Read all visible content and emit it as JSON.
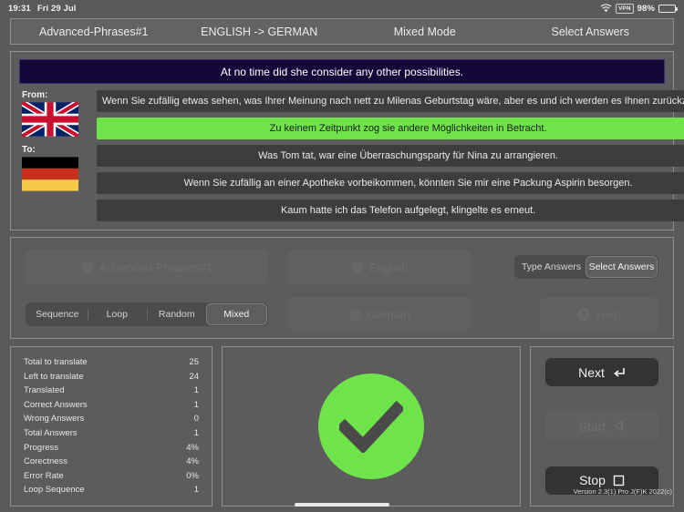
{
  "statusbar": {
    "time": "19:31",
    "date": "Fri 29 Jul",
    "vpn": "VPN",
    "battery_pct": "98%",
    "wifi_icon": "wifi-icon",
    "battery_icon": "battery-icon"
  },
  "header": {
    "tabs": [
      {
        "label": "Advanced-Phrases#1"
      },
      {
        "label": "ENGLISH -> GERMAN"
      },
      {
        "label": "Mixed Mode"
      },
      {
        "label": "Select Answers"
      }
    ]
  },
  "quiz": {
    "question": "At no time did she consider any other possibilities.",
    "from_label": "From:",
    "to_label": "To:",
    "from_flag": "uk-flag-icon",
    "to_flag": "germany-flag-icon",
    "answers": [
      {
        "text": "Wenn Sie zufällig etwas sehen, was Ihrer Meinung nach nett zu Milenas Geburtstag wäre, aber es und ich werden es Ihnen zurückzahlen.",
        "correct": false
      },
      {
        "text": "Zu keinem Zeitpunkt zog sie andere Möglichkeiten in Betracht.",
        "correct": true
      },
      {
        "text": "Was Tom tat, war eine Überraschungsparty für Nina zu arrangieren.",
        "correct": false
      },
      {
        "text": "Wenn Sie zufällig an einer Apotheke vorbeikommen, könnten Sie mir eine Packung Aspirin besorgen.",
        "correct": false
      },
      {
        "text": "Kaum hatte ich das Telefon aufgelegt, klingelte es erneut.",
        "correct": false
      }
    ]
  },
  "settings": {
    "lesson_button": "Advanced-Phrases#1",
    "from_lang_button": "English",
    "to_lang_button": "German",
    "help_button": "Help",
    "mode_segments": [
      {
        "label": "Sequence",
        "active": false
      },
      {
        "label": "Loop",
        "active": false
      },
      {
        "label": "Random",
        "active": false
      },
      {
        "label": "Mixed",
        "active": true
      }
    ],
    "answer_segments": [
      {
        "label": "Type Answers",
        "active": false
      },
      {
        "label": "Select Answers",
        "active": true
      }
    ]
  },
  "stats": [
    {
      "label": "Total to translate",
      "value": "25"
    },
    {
      "label": "Left to translate",
      "value": "24"
    },
    {
      "label": "Translated",
      "value": "1"
    },
    {
      "label": "Correct Answers",
      "value": "1"
    },
    {
      "label": "Wrong Answers",
      "value": "0"
    },
    {
      "label": "Total Answers",
      "value": "1"
    },
    {
      "label": "Progress",
      "value": "4%"
    },
    {
      "label": "Corectness",
      "value": "4%"
    },
    {
      "label": "Error Rate",
      "value": "0%"
    },
    {
      "label": "Loop Sequence",
      "value": "1"
    }
  ],
  "feedback": {
    "icon": "checkmark-circle-icon",
    "color": "#6ee44a"
  },
  "actions": [
    {
      "label": "Next",
      "icon": "enter-arrow-icon",
      "disabled": false
    },
    {
      "label": "Start",
      "icon": "play-left-icon",
      "disabled": true
    },
    {
      "label": "Stop",
      "icon": "square-stop-icon",
      "disabled": false
    }
  ],
  "version": "Version 2.3(1) Pro J(F)K 2022(c)"
}
